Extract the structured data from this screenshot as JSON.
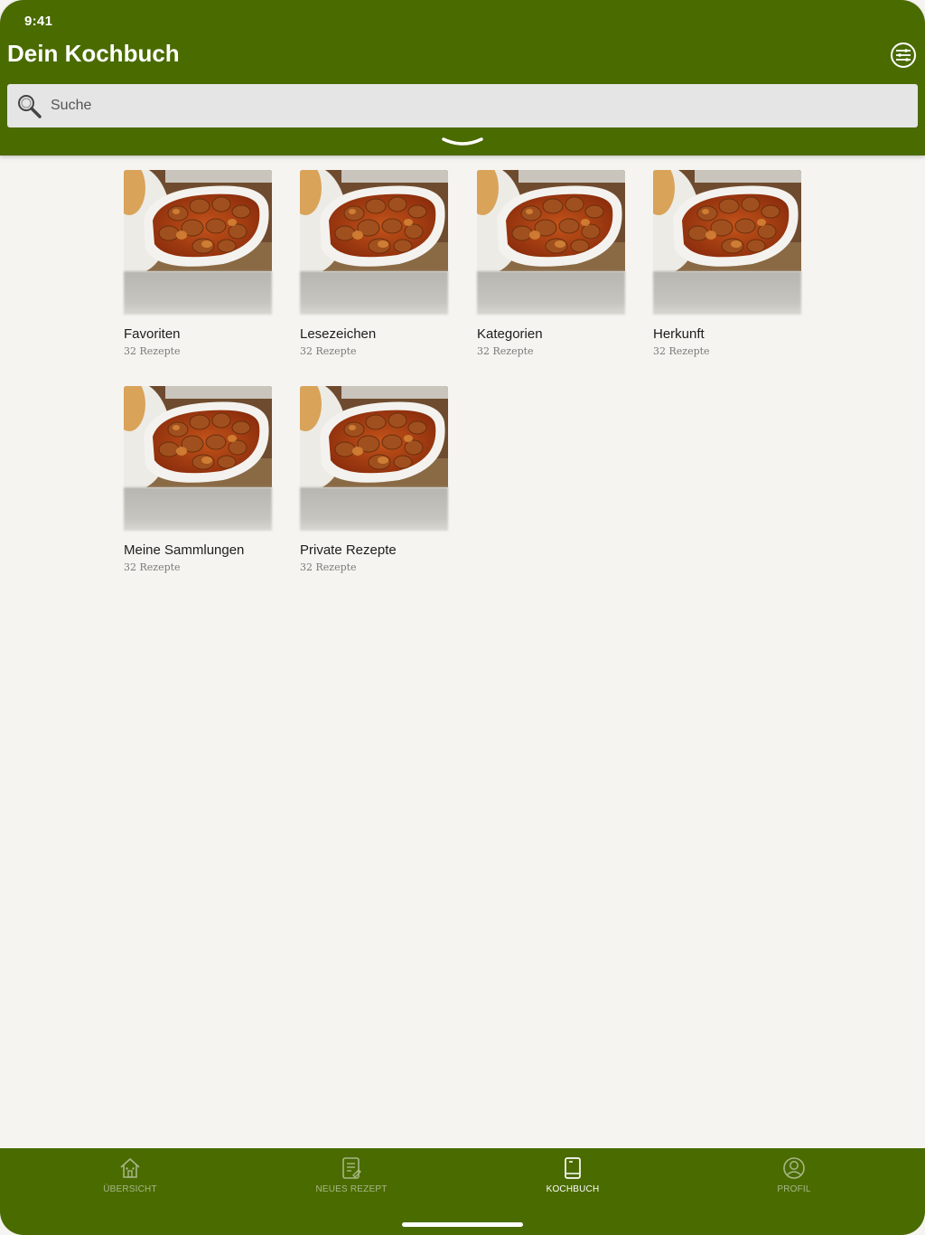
{
  "status_bar": {
    "time": "9:41"
  },
  "header": {
    "title": "Dein Kochbuch",
    "filter_icon": "sliders-icon",
    "expand_icon": "chevron-down-icon"
  },
  "search": {
    "placeholder": "Suche",
    "icon": "search-icon"
  },
  "collections": [
    {
      "title": "Favoriten",
      "count": "32 Rezepte"
    },
    {
      "title": "Lesezeichen",
      "count": "32 Rezepte"
    },
    {
      "title": "Kategorien",
      "count": "32 Rezepte"
    },
    {
      "title": "Herkunft",
      "count": "32 Rezepte"
    },
    {
      "title": "Meine Sammlungen",
      "count": "32 Rezepte"
    },
    {
      "title": "Private Rezepte",
      "count": "32 Rezepte"
    }
  ],
  "tabbar": {
    "items": [
      {
        "label": "ÜBERSICHT",
        "icon": "home-icon",
        "active": false
      },
      {
        "label": "NEUES REZEPT",
        "icon": "recipe-note-icon",
        "active": false
      },
      {
        "label": "KOCHBUCH",
        "icon": "book-icon",
        "active": true
      },
      {
        "label": "PROFIL",
        "icon": "profile-icon",
        "active": false
      }
    ]
  },
  "colors": {
    "brand_green": "#4a6b00",
    "background": "#f5f4f0",
    "tab_inactive": "#a8b887",
    "tab_active": "#ffffff"
  }
}
